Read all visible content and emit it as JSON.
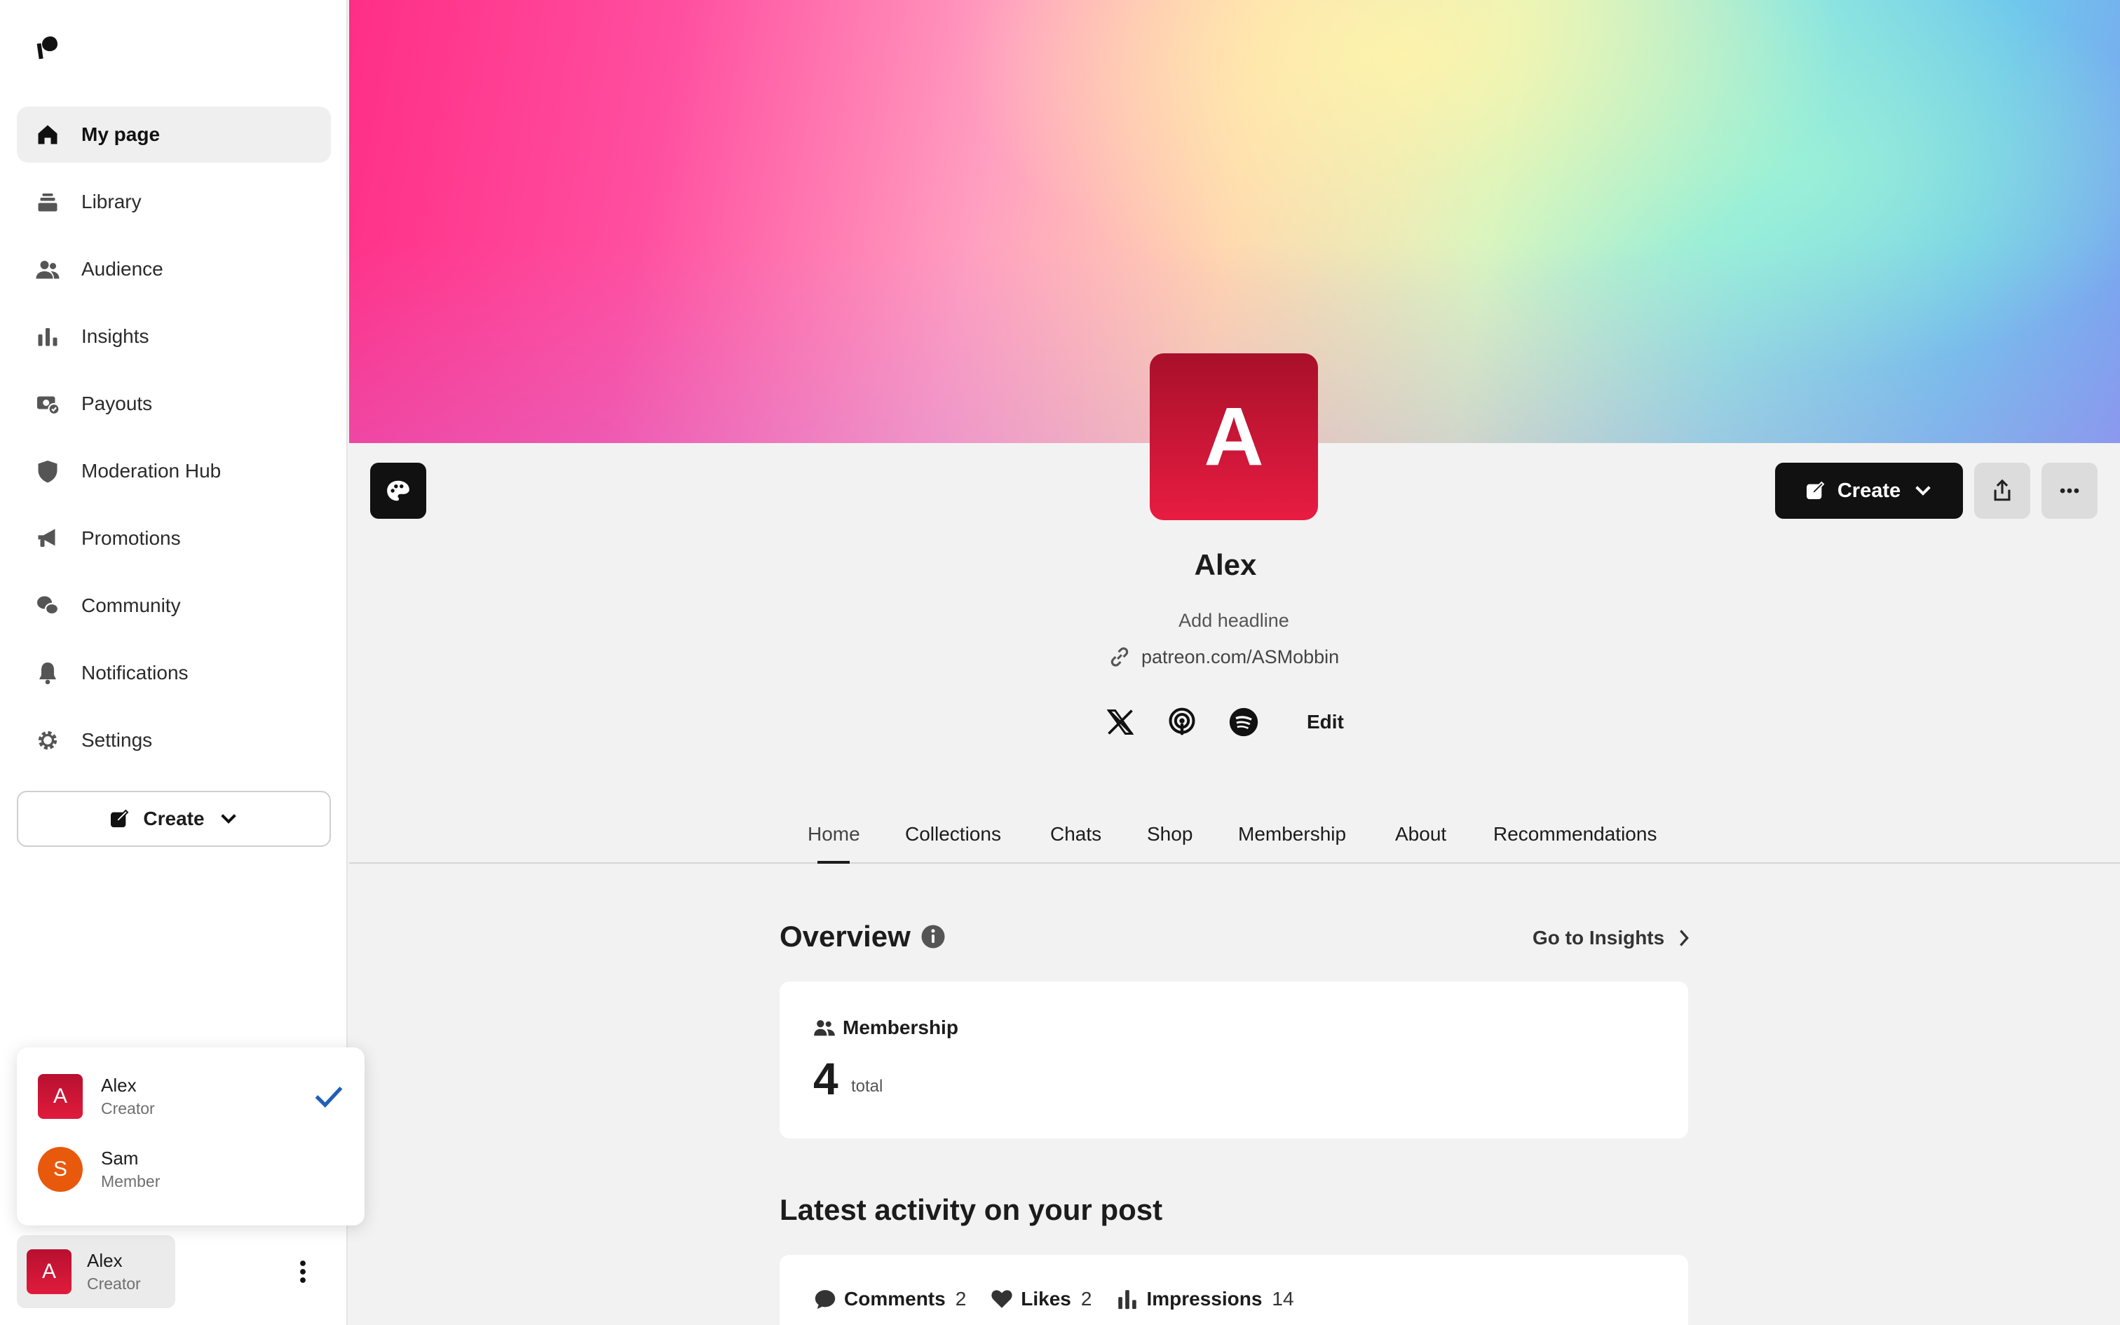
{
  "sidebar": {
    "logo_icon": "patreon-logo-icon",
    "items": [
      {
        "label": "My page",
        "icon": "home-icon",
        "active": true
      },
      {
        "label": "Library",
        "icon": "library-icon"
      },
      {
        "label": "Audience",
        "icon": "audience-icon"
      },
      {
        "label": "Insights",
        "icon": "bar-chart-icon"
      },
      {
        "label": "Payouts",
        "icon": "payouts-icon"
      },
      {
        "label": "Moderation Hub",
        "icon": "shield-icon"
      },
      {
        "label": "Promotions",
        "icon": "megaphone-icon"
      },
      {
        "label": "Community",
        "icon": "chat-bubbles-icon"
      },
      {
        "label": "Notifications",
        "icon": "bell-icon"
      },
      {
        "label": "Settings",
        "icon": "gear-icon"
      }
    ],
    "create_label": "Create"
  },
  "account_switcher": {
    "accounts": [
      {
        "initial": "A",
        "name": "Alex",
        "role": "Creator",
        "selected": true
      },
      {
        "initial": "S",
        "name": "Sam",
        "role": "Member",
        "selected": false
      }
    ],
    "current": {
      "initial": "A",
      "name": "Alex",
      "role": "Creator"
    }
  },
  "profile": {
    "avatar_initial": "A",
    "name": "Alex",
    "headline_placeholder": "Add headline",
    "link": "patreon.com/ASMobbin",
    "socials": [
      "x-icon",
      "podcast-icon",
      "spotify-icon"
    ],
    "edit_label": "Edit",
    "create_label": "Create"
  },
  "tabs": [
    "Home",
    "Collections",
    "Chats",
    "Shop",
    "Membership",
    "About",
    "Recommendations"
  ],
  "overview": {
    "title": "Overview",
    "go_insights": "Go to Insights",
    "membership_label": "Membership",
    "membership_count": "4",
    "membership_total": "total"
  },
  "activity": {
    "title": "Latest activity on your post",
    "comments_label": "Comments",
    "comments_value": "2",
    "likes_label": "Likes",
    "likes_value": "2",
    "impressions_label": "Impressions",
    "impressions_value": "14"
  },
  "colors": {
    "accent_dark": "#111111",
    "avatar_red": "#d8173a",
    "check_blue": "#1f5fb8",
    "member_orange": "#e8590c"
  }
}
